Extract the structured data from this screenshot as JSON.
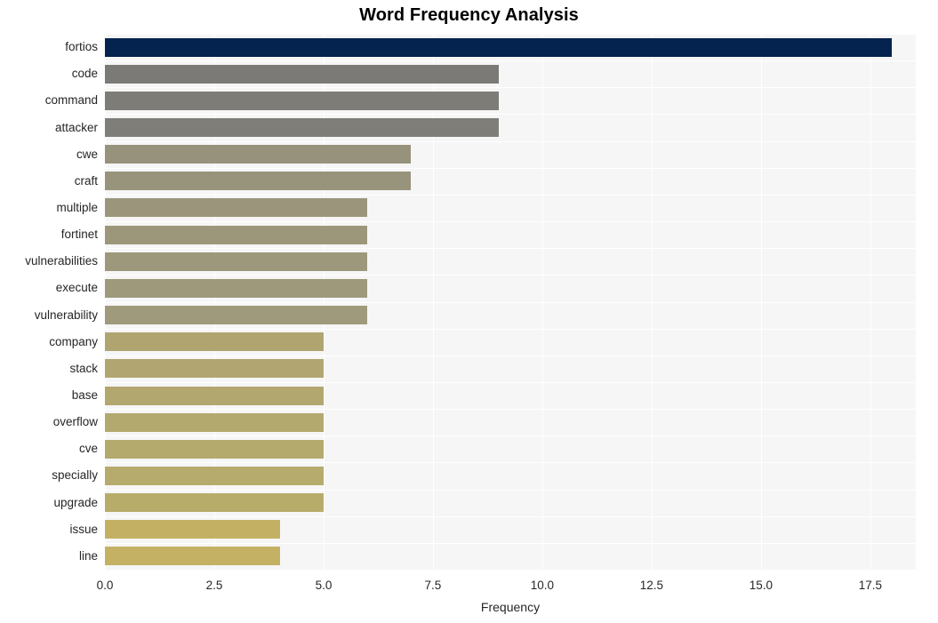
{
  "chart_data": {
    "type": "bar",
    "orientation": "horizontal",
    "title": "Word Frequency Analysis",
    "xlabel": "Frequency",
    "ylabel": "",
    "categories": [
      "fortios",
      "code",
      "command",
      "attacker",
      "cwe",
      "craft",
      "multiple",
      "fortinet",
      "vulnerabilities",
      "execute",
      "vulnerability",
      "company",
      "stack",
      "base",
      "overflow",
      "cve",
      "specially",
      "upgrade",
      "issue",
      "line"
    ],
    "values": [
      18,
      9,
      9,
      9,
      7,
      7,
      6,
      6,
      6,
      6,
      6,
      5,
      5,
      5,
      5,
      5,
      5,
      5,
      4,
      4
    ],
    "bar_colors": [
      "#04234f",
      "#7b7a76",
      "#7d7c77",
      "#7f7e79",
      "#97927b",
      "#98937b",
      "#9b967b",
      "#9c977b",
      "#9d987b",
      "#9e997b",
      "#9f9a7b",
      "#b0a571",
      "#b1a671",
      "#b2a76f",
      "#b3a86e",
      "#b5aa6d",
      "#b6ab6c",
      "#b8ac6b",
      "#c3b063",
      "#c4b164"
    ],
    "xlim": [
      0,
      18.54
    ],
    "xticks": [
      "0.0",
      "2.5",
      "5.0",
      "7.5",
      "10.0",
      "12.5",
      "15.0",
      "17.5"
    ],
    "xtick_values": [
      0,
      2.5,
      5,
      7.5,
      10,
      12.5,
      15,
      17.5
    ],
    "grid": true,
    "grid_color": "#ffffff",
    "plot_background": "#f6f6f6",
    "figure_background": "#ffffff",
    "legend": "none",
    "tick_label_color": "#262626",
    "title_color": "#000000"
  }
}
